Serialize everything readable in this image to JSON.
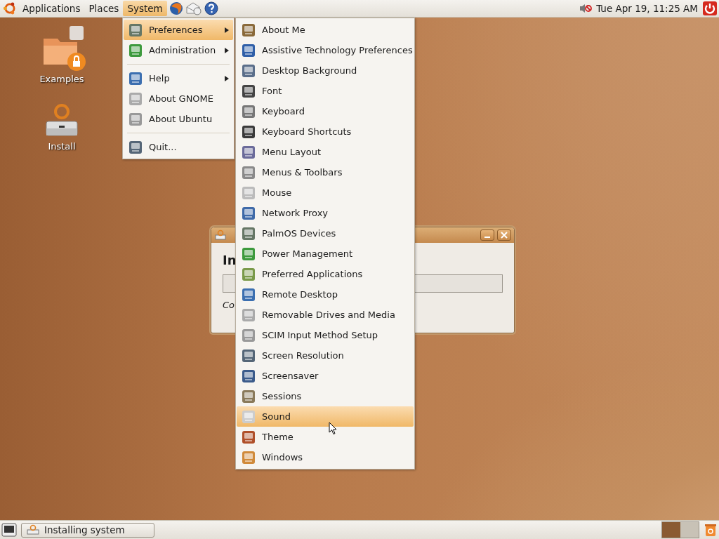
{
  "top_panel": {
    "menus": [
      {
        "label": "Applications",
        "selected": false
      },
      {
        "label": "Places",
        "selected": false
      },
      {
        "label": "System",
        "selected": true
      }
    ],
    "clock": "Tue Apr 19, 11:25 AM"
  },
  "desktop_icons": [
    {
      "label": "Examples"
    },
    {
      "label": "Install"
    }
  ],
  "dialog": {
    "heading": "In",
    "status": "Co"
  },
  "system_menu": {
    "sections": [
      [
        {
          "label": "Preferences",
          "selected": true,
          "submenu": true
        },
        {
          "label": "Administration",
          "selected": false,
          "submenu": true
        }
      ],
      [
        {
          "label": "Help",
          "selected": false,
          "submenu": true
        },
        {
          "label": "About GNOME",
          "selected": false,
          "submenu": false
        },
        {
          "label": "About Ubuntu",
          "selected": false,
          "submenu": false
        }
      ],
      [
        {
          "label": "Quit...",
          "selected": false,
          "submenu": false
        }
      ]
    ]
  },
  "preferences_menu": [
    {
      "label": "About Me",
      "selected": false
    },
    {
      "label": "Assistive Technology Preferences",
      "selected": false
    },
    {
      "label": "Desktop Background",
      "selected": false
    },
    {
      "label": "Font",
      "selected": false
    },
    {
      "label": "Keyboard",
      "selected": false
    },
    {
      "label": "Keyboard Shortcuts",
      "selected": false
    },
    {
      "label": "Menu Layout",
      "selected": false
    },
    {
      "label": "Menus & Toolbars",
      "selected": false
    },
    {
      "label": "Mouse",
      "selected": false
    },
    {
      "label": "Network Proxy",
      "selected": false
    },
    {
      "label": "PalmOS Devices",
      "selected": false
    },
    {
      "label": "Power Management",
      "selected": false
    },
    {
      "label": "Preferred Applications",
      "selected": false
    },
    {
      "label": "Remote Desktop",
      "selected": false
    },
    {
      "label": "Removable Drives and Media",
      "selected": false
    },
    {
      "label": "SCIM Input Method Setup",
      "selected": false
    },
    {
      "label": "Screen Resolution",
      "selected": false
    },
    {
      "label": "Screensaver",
      "selected": false
    },
    {
      "label": "Sessions",
      "selected": false
    },
    {
      "label": "Sound",
      "selected": true
    },
    {
      "label": "Theme",
      "selected": false
    },
    {
      "label": "Windows",
      "selected": false
    }
  ],
  "bottom_panel": {
    "tasks": [
      {
        "label": "Installing system",
        "selected": false
      }
    ],
    "workspaces": [
      {
        "selected": true
      },
      {
        "selected": false
      }
    ]
  }
}
